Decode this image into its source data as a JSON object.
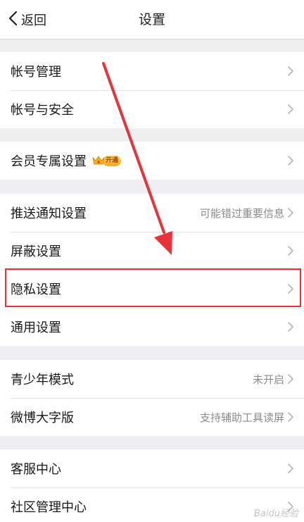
{
  "nav": {
    "back_label": "返回",
    "title": "设置"
  },
  "groups": [
    {
      "rows": [
        {
          "label": "帐号管理"
        },
        {
          "label": "帐号与安全"
        }
      ]
    },
    {
      "rows": [
        {
          "label": "会员专属设置",
          "badge": "开通"
        }
      ]
    },
    {
      "rows": [
        {
          "label": "推送通知设置",
          "value": "可能错过重要信息"
        },
        {
          "label": "屏蔽设置"
        },
        {
          "label": "隐私设置"
        },
        {
          "label": "通用设置"
        }
      ]
    },
    {
      "rows": [
        {
          "label": "青少年模式",
          "value": "未开启"
        },
        {
          "label": "微博大字版",
          "value": "支持辅助工具读屏"
        }
      ]
    },
    {
      "rows": [
        {
          "label": "客服中心"
        },
        {
          "label": "社区管理中心"
        }
      ]
    }
  ],
  "annotation": {
    "highlight_color": "#e8333a"
  },
  "watermark": "Baidu经验",
  "colors": {
    "background": "#efeef3",
    "value_text": "#8c8c8c",
    "chevron": "#b5b5b5"
  }
}
